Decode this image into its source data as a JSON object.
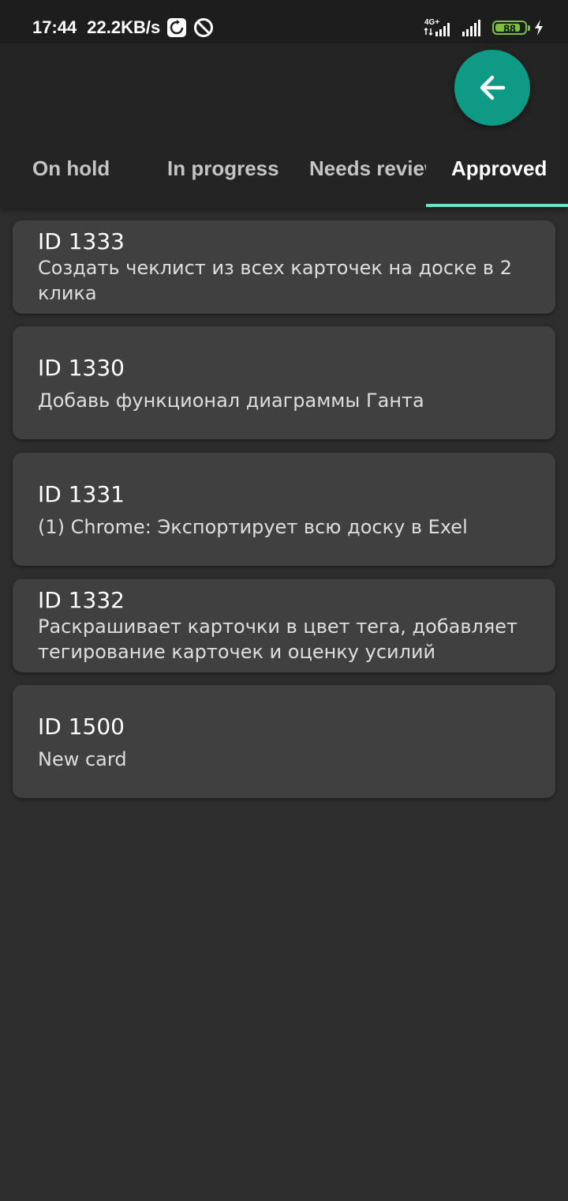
{
  "status_bar": {
    "time": "17:44",
    "network_speed": "22.2KB/s",
    "network_type": "4G+",
    "battery_percent": 88,
    "battery_label": "88",
    "icons": [
      "screenshot-icon",
      "do-not-disturb-icon",
      "signal-icon",
      "battery-icon",
      "charging-icon"
    ],
    "battery_color": "#7ac143"
  },
  "app_bar": {
    "back_icon": "arrow-left-icon",
    "accent_color": "#0f9a85",
    "tabs": [
      {
        "label": "On hold"
      },
      {
        "label": "In progress"
      },
      {
        "label": "Needs review"
      },
      {
        "label": "Approved"
      }
    ],
    "active_tab": "Approved",
    "indicator_color": "#6fe2c8"
  },
  "cards": [
    {
      "id": "ID 1333",
      "text": "Создать чеклист из всех карточек на доске в 2 клика"
    },
    {
      "id": "ID 1330",
      "text": "Добавь функционал диаграммы Ганта"
    },
    {
      "id": "ID 1331",
      "text": "(1) Chrome: Экспортирует всю доску в Exel"
    },
    {
      "id": "ID 1332",
      "text": "Раскрашивает карточки в цвет тега, добавляет тегирование карточек и оценку усилий"
    },
    {
      "id": "ID 1500",
      "text": "New card"
    }
  ]
}
